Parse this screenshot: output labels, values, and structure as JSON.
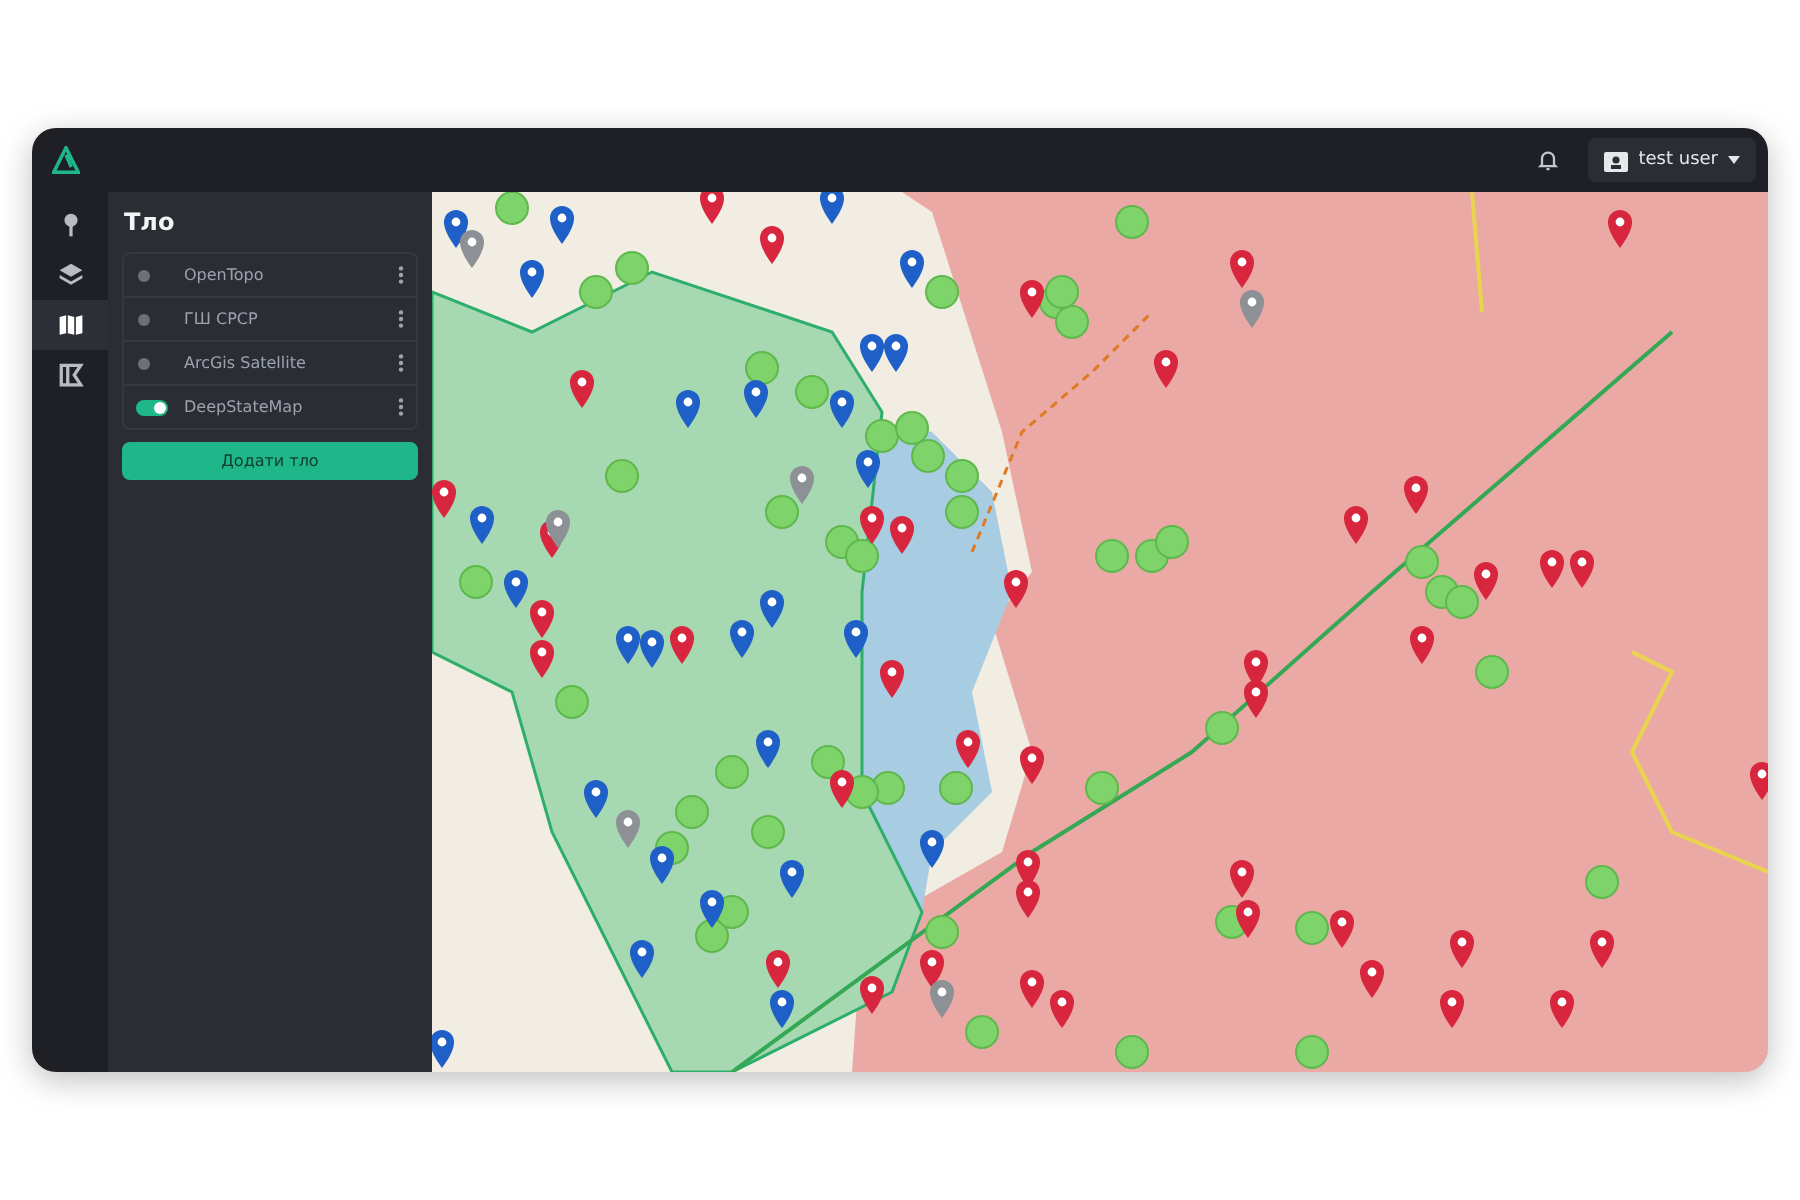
{
  "topbar": {
    "user": "test user"
  },
  "nav": [
    {
      "kind": "pin",
      "selected": false
    },
    {
      "kind": "layers",
      "selected": false
    },
    {
      "kind": "map",
      "selected": true
    },
    {
      "kind": "frame",
      "selected": false
    }
  ],
  "panel": {
    "title": "Тло",
    "layers": [
      {
        "name": "OpenTopo",
        "on": false
      },
      {
        "name": "ГШ СРСР",
        "on": false
      },
      {
        "name": "ArcGis Satellite",
        "on": false
      },
      {
        "name": "DeepStateMap",
        "on": true
      }
    ],
    "add_button": "Додати тло"
  }
}
